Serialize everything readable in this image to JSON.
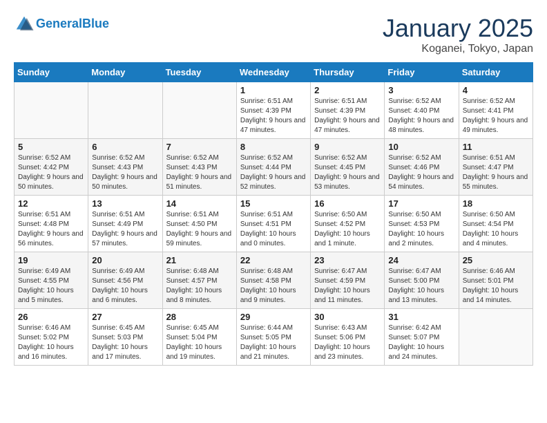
{
  "header": {
    "logo_line1": "General",
    "logo_line2": "Blue",
    "month": "January 2025",
    "location": "Koganei, Tokyo, Japan"
  },
  "days_of_week": [
    "Sunday",
    "Monday",
    "Tuesday",
    "Wednesday",
    "Thursday",
    "Friday",
    "Saturday"
  ],
  "weeks": [
    [
      {
        "day": "",
        "info": ""
      },
      {
        "day": "",
        "info": ""
      },
      {
        "day": "",
        "info": ""
      },
      {
        "day": "1",
        "info": "Sunrise: 6:51 AM\nSunset: 4:39 PM\nDaylight: 9 hours and 47 minutes."
      },
      {
        "day": "2",
        "info": "Sunrise: 6:51 AM\nSunset: 4:39 PM\nDaylight: 9 hours and 47 minutes."
      },
      {
        "day": "3",
        "info": "Sunrise: 6:52 AM\nSunset: 4:40 PM\nDaylight: 9 hours and 48 minutes."
      },
      {
        "day": "4",
        "info": "Sunrise: 6:52 AM\nSunset: 4:41 PM\nDaylight: 9 hours and 49 minutes."
      }
    ],
    [
      {
        "day": "5",
        "info": "Sunrise: 6:52 AM\nSunset: 4:42 PM\nDaylight: 9 hours and 50 minutes."
      },
      {
        "day": "6",
        "info": "Sunrise: 6:52 AM\nSunset: 4:43 PM\nDaylight: 9 hours and 50 minutes."
      },
      {
        "day": "7",
        "info": "Sunrise: 6:52 AM\nSunset: 4:43 PM\nDaylight: 9 hours and 51 minutes."
      },
      {
        "day": "8",
        "info": "Sunrise: 6:52 AM\nSunset: 4:44 PM\nDaylight: 9 hours and 52 minutes."
      },
      {
        "day": "9",
        "info": "Sunrise: 6:52 AM\nSunset: 4:45 PM\nDaylight: 9 hours and 53 minutes."
      },
      {
        "day": "10",
        "info": "Sunrise: 6:52 AM\nSunset: 4:46 PM\nDaylight: 9 hours and 54 minutes."
      },
      {
        "day": "11",
        "info": "Sunrise: 6:51 AM\nSunset: 4:47 PM\nDaylight: 9 hours and 55 minutes."
      }
    ],
    [
      {
        "day": "12",
        "info": "Sunrise: 6:51 AM\nSunset: 4:48 PM\nDaylight: 9 hours and 56 minutes."
      },
      {
        "day": "13",
        "info": "Sunrise: 6:51 AM\nSunset: 4:49 PM\nDaylight: 9 hours and 57 minutes."
      },
      {
        "day": "14",
        "info": "Sunrise: 6:51 AM\nSunset: 4:50 PM\nDaylight: 9 hours and 59 minutes."
      },
      {
        "day": "15",
        "info": "Sunrise: 6:51 AM\nSunset: 4:51 PM\nDaylight: 10 hours and 0 minutes."
      },
      {
        "day": "16",
        "info": "Sunrise: 6:50 AM\nSunset: 4:52 PM\nDaylight: 10 hours and 1 minute."
      },
      {
        "day": "17",
        "info": "Sunrise: 6:50 AM\nSunset: 4:53 PM\nDaylight: 10 hours and 2 minutes."
      },
      {
        "day": "18",
        "info": "Sunrise: 6:50 AM\nSunset: 4:54 PM\nDaylight: 10 hours and 4 minutes."
      }
    ],
    [
      {
        "day": "19",
        "info": "Sunrise: 6:49 AM\nSunset: 4:55 PM\nDaylight: 10 hours and 5 minutes."
      },
      {
        "day": "20",
        "info": "Sunrise: 6:49 AM\nSunset: 4:56 PM\nDaylight: 10 hours and 6 minutes."
      },
      {
        "day": "21",
        "info": "Sunrise: 6:48 AM\nSunset: 4:57 PM\nDaylight: 10 hours and 8 minutes."
      },
      {
        "day": "22",
        "info": "Sunrise: 6:48 AM\nSunset: 4:58 PM\nDaylight: 10 hours and 9 minutes."
      },
      {
        "day": "23",
        "info": "Sunrise: 6:47 AM\nSunset: 4:59 PM\nDaylight: 10 hours and 11 minutes."
      },
      {
        "day": "24",
        "info": "Sunrise: 6:47 AM\nSunset: 5:00 PM\nDaylight: 10 hours and 13 minutes."
      },
      {
        "day": "25",
        "info": "Sunrise: 6:46 AM\nSunset: 5:01 PM\nDaylight: 10 hours and 14 minutes."
      }
    ],
    [
      {
        "day": "26",
        "info": "Sunrise: 6:46 AM\nSunset: 5:02 PM\nDaylight: 10 hours and 16 minutes."
      },
      {
        "day": "27",
        "info": "Sunrise: 6:45 AM\nSunset: 5:03 PM\nDaylight: 10 hours and 17 minutes."
      },
      {
        "day": "28",
        "info": "Sunrise: 6:45 AM\nSunset: 5:04 PM\nDaylight: 10 hours and 19 minutes."
      },
      {
        "day": "29",
        "info": "Sunrise: 6:44 AM\nSunset: 5:05 PM\nDaylight: 10 hours and 21 minutes."
      },
      {
        "day": "30",
        "info": "Sunrise: 6:43 AM\nSunset: 5:06 PM\nDaylight: 10 hours and 23 minutes."
      },
      {
        "day": "31",
        "info": "Sunrise: 6:42 AM\nSunset: 5:07 PM\nDaylight: 10 hours and 24 minutes."
      },
      {
        "day": "",
        "info": ""
      }
    ]
  ]
}
